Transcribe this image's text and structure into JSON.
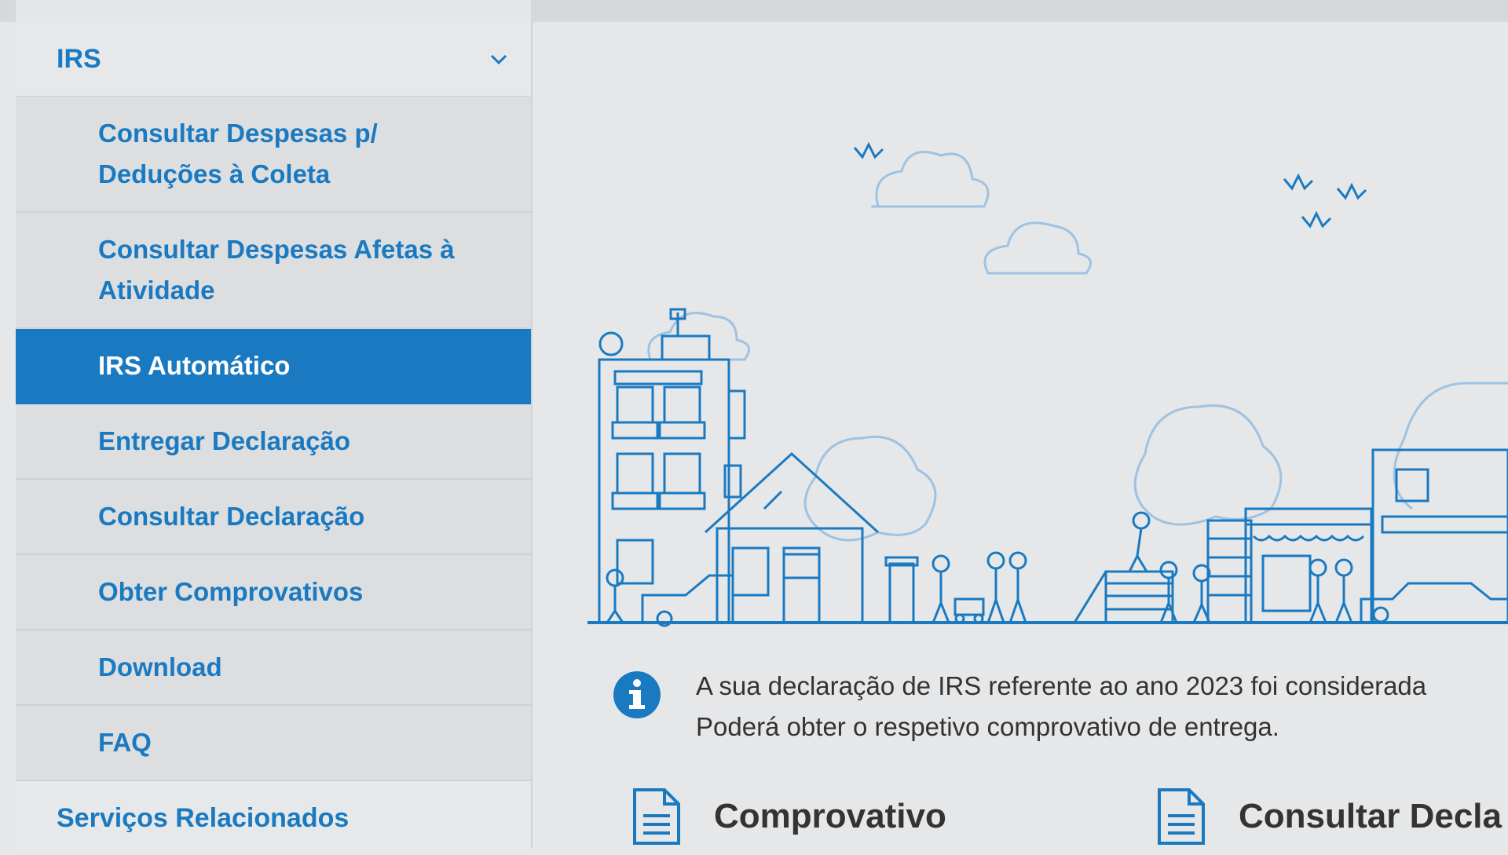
{
  "sidebar": {
    "header": "IRS",
    "items": [
      {
        "label_line1": "Consultar Despesas p/",
        "label_line2": "Deduções à Coleta"
      },
      {
        "label_line1": "Consultar Despesas Afetas à",
        "label_line2": "Atividade"
      },
      {
        "label": "IRS Automático",
        "active": true
      },
      {
        "label": "Entregar Declaração"
      },
      {
        "label": "Consultar Declaração"
      },
      {
        "label": "Obter Comprovativos"
      },
      {
        "label": "Download"
      },
      {
        "label": "FAQ"
      }
    ],
    "footer": "Serviços Relacionados"
  },
  "main": {
    "info_line1": "A sua declaração de IRS referente ao ano 2023 foi considerada",
    "info_line2": "Poderá obter o respetivo comprovativo de entrega.",
    "action_comprovativo": "Comprovativo",
    "action_consultar": "Consultar Decla"
  },
  "colors": {
    "accent": "#1a7ac1",
    "text": "#333333",
    "background": "#e6e7e9"
  }
}
